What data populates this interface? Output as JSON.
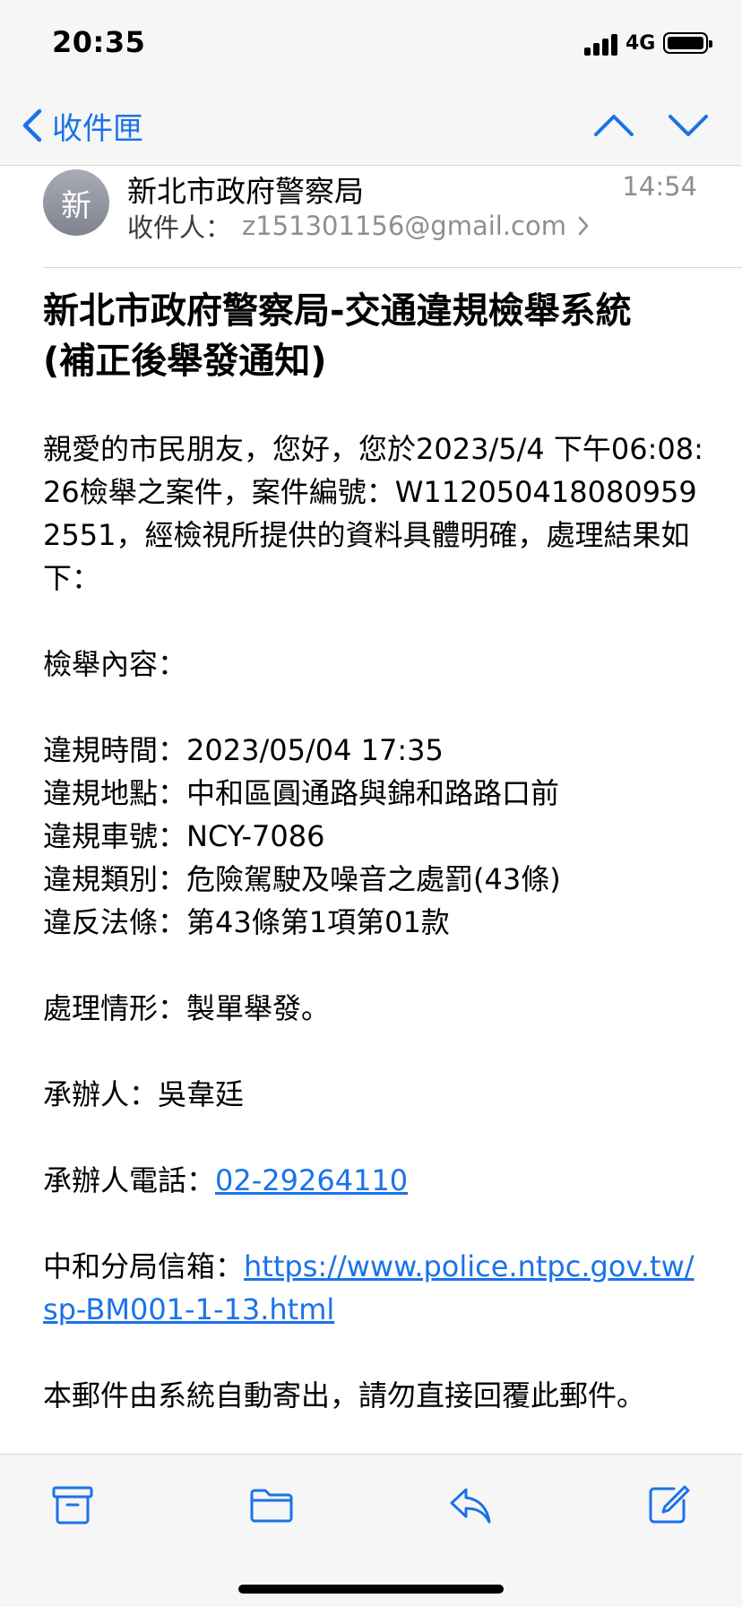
{
  "status_bar": {
    "time": "20:35",
    "network": "4G"
  },
  "nav": {
    "back_label": "收件匣"
  },
  "email": {
    "avatar_initial": "新",
    "sender": "新北市政府警察局",
    "time": "14:54",
    "recipient_label": "收件人：",
    "recipient": "z151301156@gmail.com",
    "subject": "新北市政府警察局-交通違規檢舉系統 (補正後舉發通知)",
    "body": {
      "intro": "親愛的市民朋友，您好，您於2023/5/4 下午06:08:26檢舉之案件，案件編號：W1120504180809592551，經檢視所提供的資料具體明確，處理結果如下：",
      "section_title": "檢舉內容：",
      "details": [
        "違規時間：2023/05/04 17:35",
        "違規地點：中和區圓通路與錦和路路口前",
        "違規車號：NCY-7086",
        "違規類別：危險駕駛及噪音之處罰(43條)",
        "違反法條：第43條第1項第01款"
      ],
      "handling": "處理情形：製單舉發。",
      "officer": "承辦人：吳韋廷",
      "phone_label": "承辦人電話：",
      "phone": "02-29264110",
      "mailbox_label": "中和分局信箱：",
      "mailbox_url": "https://www.police.ntpc.gov.tw/sp-BM001-1-13.html",
      "footer": "本郵件由系統自動寄出，請勿直接回覆此郵件。"
    }
  },
  "colors": {
    "accent": "#1a73e8",
    "secondary_text": "#8e8e93",
    "bar_bg": "#f6f6f6"
  },
  "toolbar": {
    "icons": [
      "archive-icon",
      "folder-icon",
      "reply-icon",
      "compose-icon"
    ]
  }
}
